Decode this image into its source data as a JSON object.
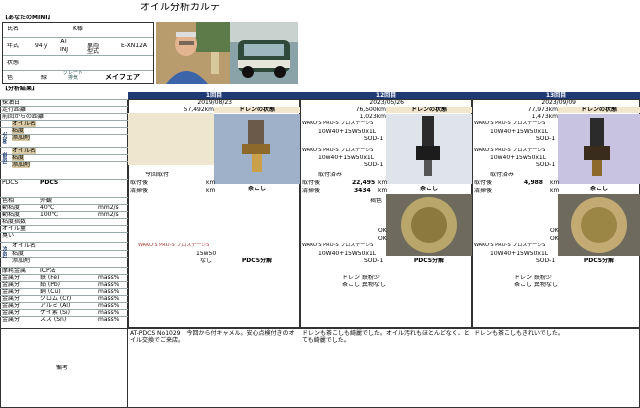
{
  "sheet_title": "オイル分析カルテ",
  "sections": {
    "you": "【あなたのMINI】",
    "results": "【分析結果】"
  },
  "profile": {
    "name_label": "氏名",
    "name_value": "K様",
    "age_label": "年式",
    "age_value": "94ｙ",
    "transmission": "AT",
    "fuel": "INJ",
    "ac": "車両\n型式",
    "model_code": "E-XN12A",
    "condition_label": "状態",
    "color_label": "色",
    "color_value": "緑",
    "grade_label": "グレード\n排気",
    "grade_value": "メイフェア"
  },
  "row_labels": [
    "採油日",
    "走行距離",
    "前回からの距離",
    "オイル名",
    "粘度",
    "添加剤",
    "オイル名",
    "粘度",
    "添加剤",
    "PDCS",
    "色相",
    "動粘度",
    "動粘度",
    "粘度指数",
    "オイル量",
    "臭い",
    "オイル名",
    "粘度",
    "添加剤",
    "摩耗金属",
    "金属分",
    "金属分",
    "金属分",
    "金属分",
    "金属分",
    "金属分",
    "金属分",
    "備考"
  ],
  "group_labels": {
    "analysis": "分析",
    "prev": "前回",
    "next": "次回"
  },
  "sub_labels": {
    "hue_val": "外観",
    "visc40": "40℃",
    "visc100": "100℃",
    "unit_visc": "mm2/s",
    "metal_group": "ICP法",
    "metals": [
      "鉄 (Fe)",
      "鉛 (Pb)",
      "銅 (Cu)",
      "クロム (Cr)",
      "アルミ (Al)",
      "ケイ素 (Si)",
      "スズ (Sn)"
    ],
    "mass_unit": "mass%"
  },
  "rounds": [
    {
      "title": "1回目",
      "date": "2019/08/23",
      "distance": "57,492km",
      "drain_label": "ドレンの状態",
      "pdcs_a": "今回取付",
      "pdcs_b": "取付後",
      "pdcs_c": "清掃後",
      "unit_km": "km",
      "strainer": "茶こし",
      "pdcs_sub": "PDCS分解",
      "next_oil": "WAKO'S PRO-S プロステージS",
      "next_visc": "15w50",
      "next_additive": "なし",
      "remarks": "AT-PDCS No1029　今回から付キャメル。安心点検付きのオイル交換でご来店。"
    },
    {
      "title": "12回目",
      "date": "2023/05/26",
      "distance": "76,500km",
      "delta": "1,023km",
      "drain_label": "ドレンの状態",
      "oil": "WAKO'S PRO-S プロステージS",
      "visc": "10W40+15W50x1L",
      "additive": "SOD-1",
      "prev_oil": "WAKO'S PRO-S プロステージS",
      "prev_visc": "10w40+15w50x1L",
      "prev_additive": "SOD-1",
      "pdcs_a": "取付済み",
      "pdcs_b": "取付後",
      "pdcs_b_val": "22,495",
      "pdcs_c": "清掃後",
      "pdcs_c_val": "3434",
      "unit_km": "km",
      "strainer": "茶こし",
      "hue": "褐色",
      "ok1": "OK",
      "ok2": "OK",
      "next_oil": "WAKO'S PRO-S プロステージS",
      "next_visc": "10W40+15W50x1L",
      "next_additive": "SOD-1",
      "pdcs_sub": "PDCS分解",
      "note1": "ドレン 鉄粉少",
      "note2": "茶こし 異物なし",
      "remarks": "ドレンも茶こしも綺麗でした。オイル汚れもほとんどなく、とても綺麗でした。"
    },
    {
      "title": "13回目",
      "date": "2023/09/09",
      "distance": "77,973km",
      "delta": "1,473km",
      "drain_label": "ドレンの状態",
      "oil": "WAKO'S PRO-S プロステージS",
      "visc": "10W40+15W50x1L",
      "additive": "SOD-1",
      "prev_oil": "WAKO'S PRO-S プロステージS",
      "prev_visc": "10w40+15w50x1L",
      "prev_additive": "SOD-1",
      "pdcs_a": "取付済み",
      "pdcs_b": "取付後",
      "pdcs_b_val": "4,988",
      "pdcs_c": "清掃後",
      "unit_km": "km",
      "strainer": "茶こし",
      "hue": "",
      "ok1": "OK",
      "ok2": "OK",
      "next_oil": "WAKO'S PRO-S プロステージS",
      "next_visc": "10W40+15W50x1L",
      "next_additive": "SOD-1",
      "pdcs_sub": "PDCS分解",
      "note1": "ドレン 鉄粉少",
      "note2": "茶こし 異物なし",
      "remarks": "ドレンも茶こしもきれいでした。"
    }
  ],
  "remarks_label": "備考"
}
